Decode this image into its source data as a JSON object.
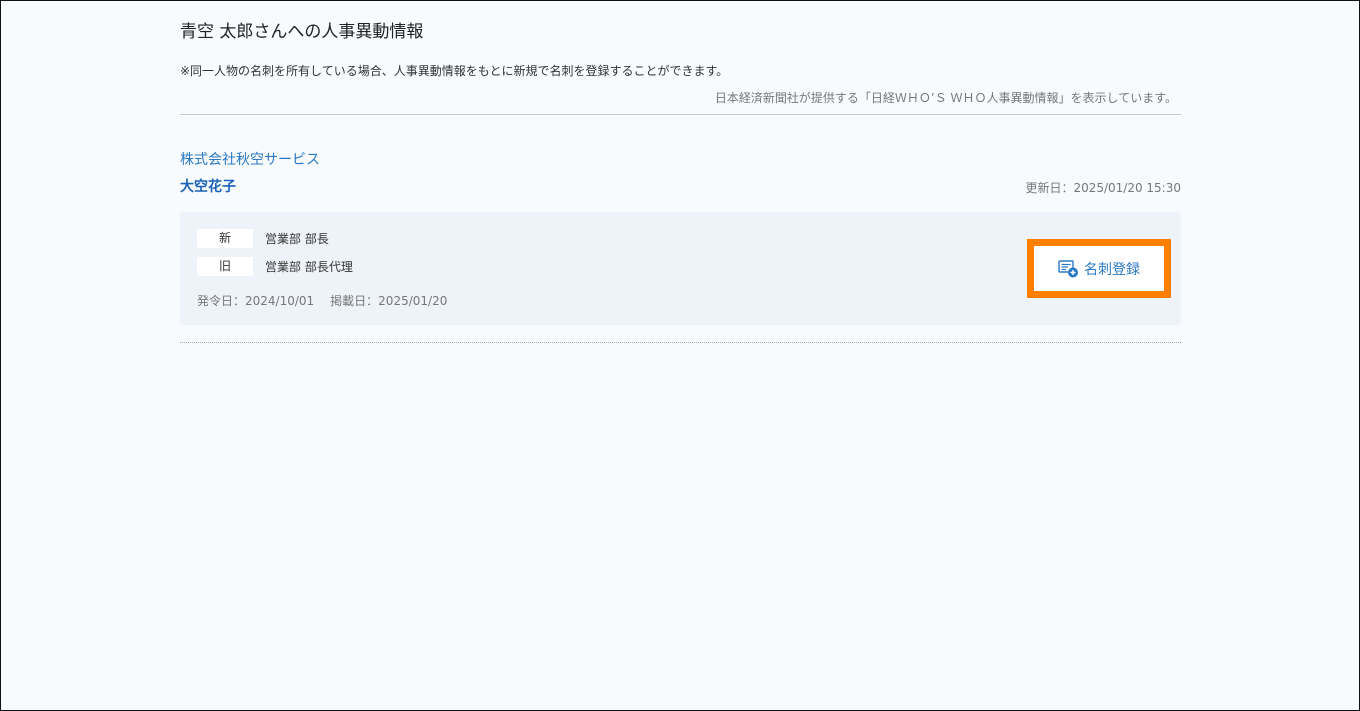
{
  "page": {
    "title": "青空 太郎さんへの人事異動情報",
    "note": "※同一人物の名刺を所有している場合、人事異動情報をもとに新規で名刺を登録することができます。",
    "source": "日本経済新聞社が提供する「日経ＷＨＯ’Ｓ ＷＨＯ人事異動情報」を表示しています。"
  },
  "entry": {
    "company": "株式会社秋空サービス",
    "person": "大空花子",
    "updated": "更新日：2025/01/20 15:30",
    "new_tag": "新",
    "new_position": "営業部 部長",
    "old_tag": "旧",
    "old_position": "営業部 部長代理",
    "issue_date": "発令日：2024/10/01",
    "publish_date": "掲載日：2025/01/20",
    "register_button": "名刺登録",
    "register_icon": "card-add-icon"
  },
  "colors": {
    "background": "#f7fbfe",
    "link_blue": "#2a78c2",
    "card_bg": "#eef3f9",
    "highlight_orange": "#ff8000"
  }
}
